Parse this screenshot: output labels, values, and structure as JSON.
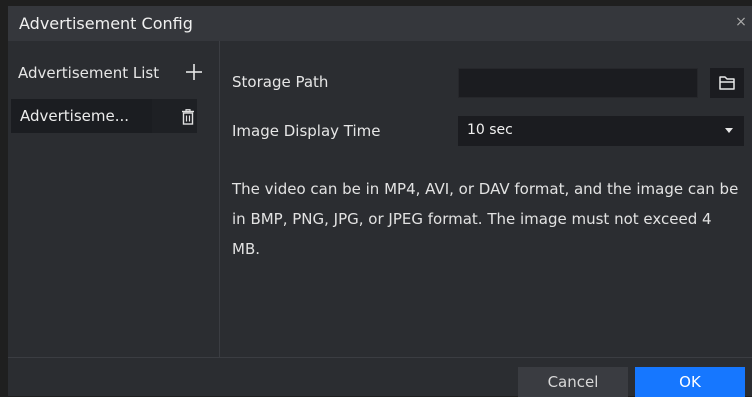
{
  "dialog": {
    "title": "Advertisement Config",
    "close_glyph": "×"
  },
  "sidebar": {
    "header": "Advertisement List",
    "add_icon": "plus-icon",
    "items": [
      {
        "label": "Advertiseme...",
        "action_icon": "trash-icon"
      }
    ]
  },
  "form": {
    "storage_path": {
      "label": "Storage Path",
      "value": "",
      "icon": "folder-icon"
    },
    "image_display_time": {
      "label": "Image Display Time",
      "selected": "10 sec"
    },
    "note": "The video can be in MP4, AVI, or DAV format, and the image can be in BMP, PNG, JPG, or JPEG format. The image must not exceed 4 MB."
  },
  "footer": {
    "cancel_label": "Cancel",
    "ok_label": "OK"
  },
  "colors": {
    "accent": "#1677ff",
    "dialog_bg": "#2b2d31",
    "titlebar_bg": "#35373c"
  }
}
